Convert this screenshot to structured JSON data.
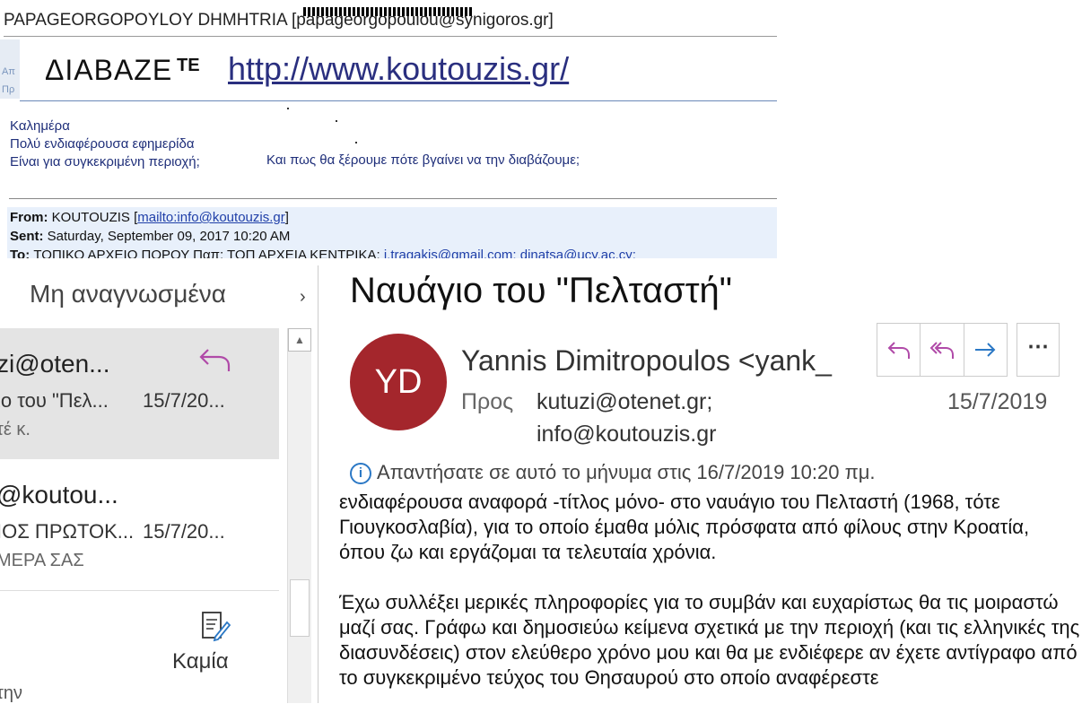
{
  "top_email": {
    "sender": "PAPAGEORGOPOYLOY DHMHTRIA [papageorgopoulou@synigoros.gr]",
    "banner_side": [
      "Απ",
      "Πρ"
    ],
    "banner_title": "ΔΙΑΒΑΖΕ",
    "banner_te": "ΤΕ",
    "banner_link": "http://www.koutouzis.gr/",
    "greeting_lines": [
      "Καλημέρα",
      "Πολύ ενδιαφέρουσα εφημερίδα",
      "Είναι για συγκεκριμένη περιοχή;"
    ],
    "question": "Και πως θα ξέρουμε πότε βγαίνει να την διαβάζουμε;",
    "from_label": "From:",
    "from_value": "KOUTOUZIS [",
    "from_link": "mailto:info@koutouzis.gr",
    "from_close": "]",
    "sent_label": "Sent:",
    "sent_value": "Saturday, September 09, 2017 10:20 AM",
    "to_label": "To:",
    "to_value": "ΤΟΠΙΚΟ ΑΡΧΕΙΟ ΠΟΡΟΥ Παπ; ΤΟΠ ΑΡΧΕΙΑ ΚΕΝΤΡΙΚΑ; ",
    "to_links": "i.tragakis@gmail.com; dinatsa@ucy.ac.cy;"
  },
  "mail_list": {
    "filter_label": "Μη αναγνωσμένα",
    "items": [
      {
        "sender": "zi@oten...",
        "subject": "ιο του \"Πελ...",
        "date": "15/7/20...",
        "preview": "τέ κ."
      },
      {
        "sender": "@koutou...",
        "subject": "ΙΟΣ ΠΡΩΤΟΚ...",
        "date": "15/7/20...",
        "preview": "ΜΕΡΑ ΣΑΣ"
      }
    ],
    "note_label": "Καμία",
    "partial_text": "την"
  },
  "reading_pane": {
    "subject": "Ναυάγιο του \"Πελταστή\"",
    "avatar_initials": "YD",
    "from": "Yannis Dimitropoulos <yank_",
    "to_label": "Προς",
    "to_1": "kutuzi@otenet.gr;",
    "to_2": "info@koutouzis.gr",
    "date": "15/7/2019",
    "info_icon": "i",
    "info": "Απαντήσατε σε αυτό το μήνυμα στις 16/7/2019 10:20 πμ.",
    "body_1": "ενδιαφέρουσα αναφορά -τίτλος μόνο- στο ναυάγιο του Πελταστή (1968, τότε Γιουγκοσλαβία), για το οποίο έμαθα μόλις πρόσφατα από φίλους στην Κροατία, όπου ζω και εργάζομαι τα τελευταία χρόνια.",
    "body_2": "Έχω συλλέξει μερικές πληροφορίες για το συμβάν και ευχαρίστως θα τις μοιραστώ μαζί σας. Γράφω και δημοσιεύω κείμενα σχετικά με την περιοχή (και τις ελληνικές της διασυνδέσεις) στον ελεύθερο χρόνο μου και θα με ενδιέφερε αν έχετε αντίγραφο από το συγκεκριμένο τεύχος του Θησαυρού στο οποίο αναφέρεστε"
  },
  "colors": {
    "avatar": "#a4262c",
    "reply_icon": "#b04aa8",
    "forward_icon": "#2b78c5",
    "link": "#2a2f7f"
  }
}
